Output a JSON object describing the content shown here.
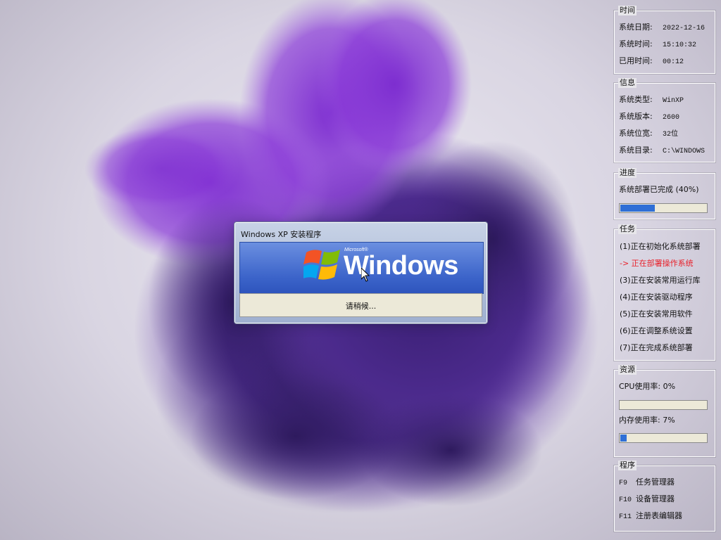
{
  "time_panel": {
    "title": "时间",
    "rows": [
      {
        "label": "系统日期:",
        "value": "2022-12-16"
      },
      {
        "label": "系统时间:",
        "value": "15:10:32"
      },
      {
        "label": "已用时间:",
        "value": "00:12"
      }
    ]
  },
  "info_panel": {
    "title": "信息",
    "rows": [
      {
        "label": "系统类型:",
        "value": "WinXP"
      },
      {
        "label": "系统版本:",
        "value": "2600"
      },
      {
        "label": "系统位宽:",
        "value": "32位"
      },
      {
        "label": "系统目录:",
        "value": "C:\\WINDOWS"
      }
    ]
  },
  "progress_panel": {
    "title": "进度",
    "status": "系统部署已完成 (40%)",
    "percent": 40
  },
  "tasks_panel": {
    "title": "任务",
    "items": [
      {
        "text": "(1)正在初始化系统部署",
        "active": false
      },
      {
        "text": "-> 正在部署操作系统",
        "active": true
      },
      {
        "text": "(3)正在安装常用运行库",
        "active": false
      },
      {
        "text": "(4)正在安装驱动程序",
        "active": false
      },
      {
        "text": "(5)正在安装常用软件",
        "active": false
      },
      {
        "text": "(6)正在调整系统设置",
        "active": false
      },
      {
        "text": "(7)正在完成系统部署",
        "active": false
      }
    ]
  },
  "resources_panel": {
    "title": "资源",
    "cpu_label": "CPU使用率:  0%",
    "cpu_percent": 0,
    "mem_label": "内存使用率:  7%",
    "mem_percent": 7
  },
  "programs_panel": {
    "title": "程序",
    "items": [
      {
        "key": "F9",
        "label": "任务管理器"
      },
      {
        "key": "F10",
        "label": "设备管理器"
      },
      {
        "key": "F11",
        "label": "注册表编辑器"
      }
    ]
  },
  "dialog": {
    "title": "Windows XP 安装程序",
    "brand_small": "Microsoft®",
    "brand": "Windows",
    "status": "请稍候..."
  },
  "colors": {
    "accent": "#2f6fd6",
    "active_task": "#e8202a",
    "smoke": "#5a2a9a"
  },
  "icons": [
    "windows-flag-icon",
    "mouse-cursor-icon"
  ]
}
